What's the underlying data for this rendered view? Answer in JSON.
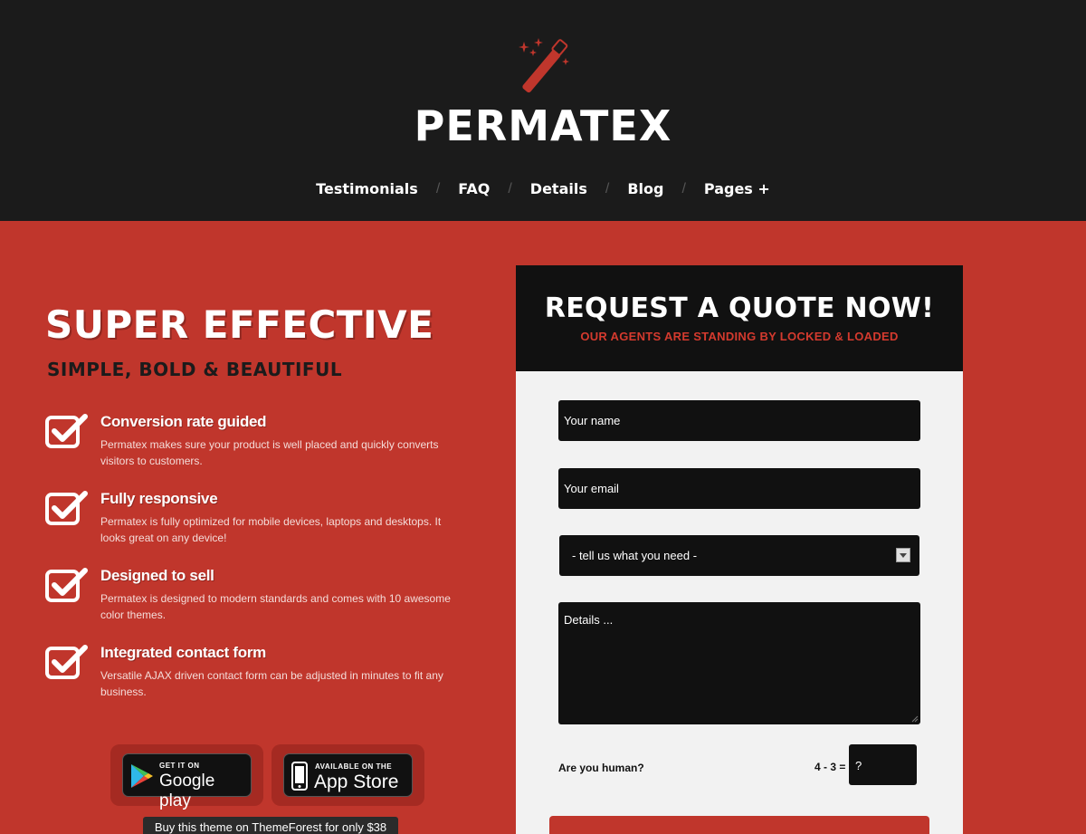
{
  "header": {
    "brand": "PERMATEX",
    "nav": [
      "Testimonials",
      "FAQ",
      "Details",
      "Blog",
      "Pages +"
    ],
    "nav_separator": "/"
  },
  "hero": {
    "title": "SUPER EFFECTIVE",
    "subtitle": "SIMPLE, BOLD & BEAUTIFUL",
    "features": [
      {
        "title": "Conversion rate guided",
        "desc": "Permatex makes sure your product is well placed and quickly converts visitors to customers."
      },
      {
        "title": "Fully responsive",
        "desc": "Permatex is fully optimized for mobile devices, laptops and desktops. It looks great on any device!"
      },
      {
        "title": "Designed to sell",
        "desc": "Permatex is designed to modern standards and comes with 10 awesome color themes."
      },
      {
        "title": "Integrated contact form",
        "desc": "Versatile AJAX driven contact form can be adjusted in minutes to fit any business."
      }
    ]
  },
  "stores": {
    "google_small": "GET IT ON",
    "google_big": "Google play",
    "apple_small": "AVAILABLE ON THE",
    "apple_big": "App Store"
  },
  "buy_bar": "Buy this theme on ThemeForest for only $38",
  "quote": {
    "title": "REQUEST A QUOTE NOW!",
    "subtitle": "OUR AGENTS ARE STANDING BY LOCKED & LOADED",
    "name_placeholder": "Your name",
    "email_placeholder": "Your email",
    "select_value": "- tell us what you need -",
    "details_placeholder": "Details ...",
    "human_label": "Are you human?",
    "math_label": "4 - 3 =",
    "captcha_placeholder": "?"
  },
  "colors": {
    "brand_red": "#c0362c",
    "header_bg": "#1b1b1b",
    "panel_bg": "#f2f2f2"
  }
}
